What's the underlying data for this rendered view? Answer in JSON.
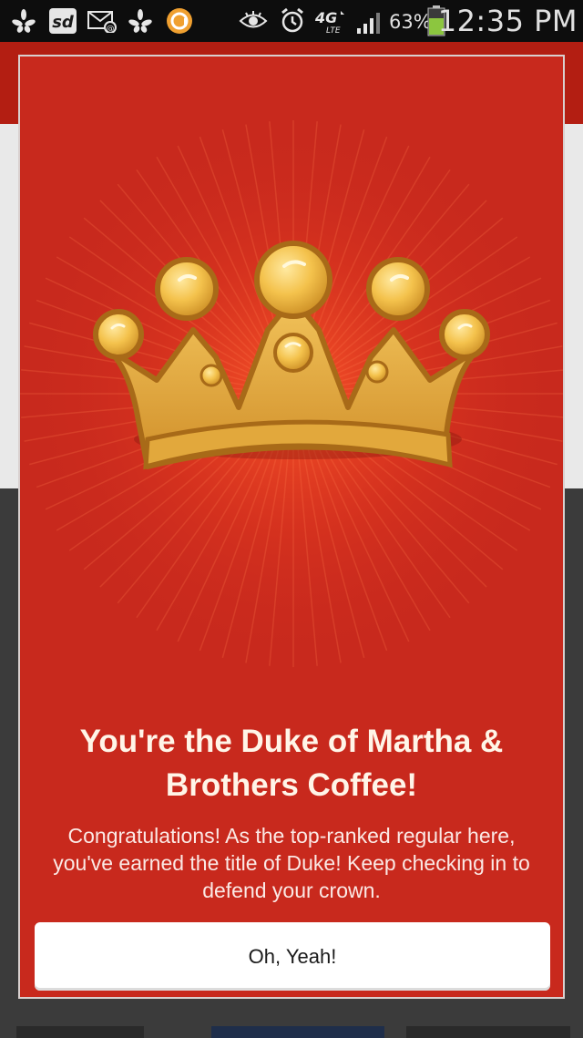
{
  "status_bar": {
    "time": "12:35 PM",
    "battery_percent": "63%",
    "network": "4G LTE",
    "notification_icons": [
      "yelp-icon",
      "sd-icon",
      "email-icon",
      "yelp-icon",
      "app-icon"
    ],
    "system_icons": [
      "eye-icon",
      "alarm-icon",
      "network-4g-lte-icon",
      "signal-icon",
      "battery-icon"
    ]
  },
  "dialog": {
    "headline": "You're the Duke of Martha & Brothers Coffee!",
    "body": "Congratulations! As the top-ranked regular here, you've earned the title of Duke! Keep checking in to defend your crown.",
    "button_label": "Oh, Yeah!",
    "image": "crown-icon"
  },
  "colors": {
    "dialog_background": "#c8291d",
    "crown_gold": "#e0a83a",
    "button_background": "#ffffff",
    "status_bar": "#0d0d0d"
  }
}
